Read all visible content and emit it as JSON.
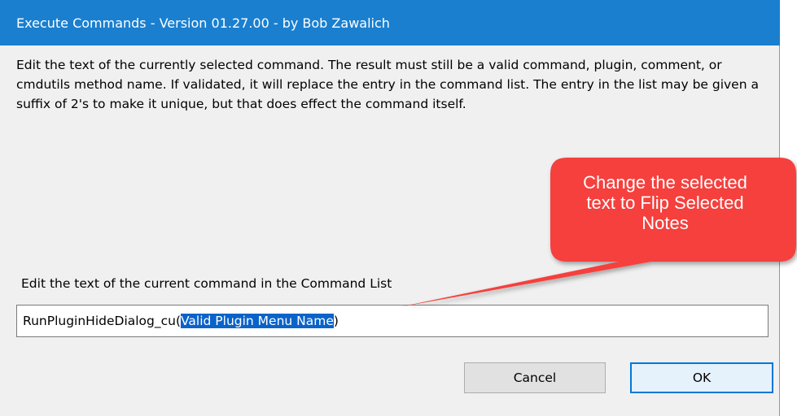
{
  "window": {
    "title": "Execute Commands - Version 01.27.00 - by Bob Zawalich"
  },
  "dialog": {
    "description": "Edit the text of the currently selected command. The result must still be a valid command, plugin, comment, or cmdutils method name. If validated, it will replace the entry in the command list. The entry in the list may be given a suffix of 2's to make it unique, but that does effect the command itself.",
    "field_label": "Edit the text of the current command in the Command List",
    "input": {
      "prefix": "RunPluginHideDialog_cu(",
      "selected": "Valid Plugin Menu Name",
      "suffix": ")"
    },
    "buttons": {
      "cancel": "Cancel",
      "ok": "OK"
    }
  },
  "annotation": {
    "lines": [
      "Change the selected",
      "text to Flip Selected",
      "Notes"
    ],
    "color": "#f5403c"
  },
  "colors": {
    "titlebar": "#1a7fcf",
    "selection": "#0a63c9",
    "accent": "#0078d7"
  }
}
